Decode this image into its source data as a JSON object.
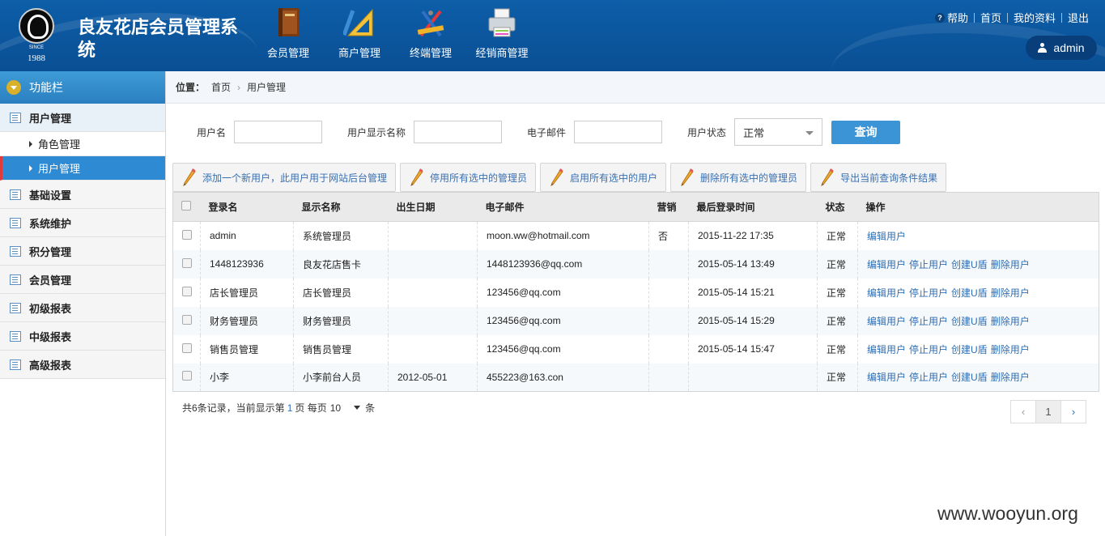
{
  "app": {
    "title": "良友花店会员管理系统",
    "logo_since": "SINCE",
    "logo_year": "1988"
  },
  "topnav": [
    {
      "label": "会员管理",
      "icon": "book-icon"
    },
    {
      "label": "商户管理",
      "icon": "ruler-triangle-icon"
    },
    {
      "label": "终端管理",
      "icon": "drafting-tools-icon"
    },
    {
      "label": "经销商管理",
      "icon": "printer-icon"
    }
  ],
  "toplinks": {
    "help": "帮助",
    "home": "首页",
    "profile": "我的资料",
    "logout": "退出"
  },
  "user": {
    "name": "admin"
  },
  "sidebar": {
    "header": "功能栏",
    "groups": [
      {
        "label": "用户管理",
        "subs": [
          {
            "label": "角色管理"
          },
          {
            "label": "用户管理"
          }
        ]
      },
      {
        "label": "基础设置"
      },
      {
        "label": "系统维护"
      },
      {
        "label": "积分管理"
      },
      {
        "label": "会员管理"
      },
      {
        "label": "初级报表"
      },
      {
        "label": "中级报表"
      },
      {
        "label": "高级报表"
      }
    ]
  },
  "breadcrumb": {
    "label": "位置：",
    "home": "首页",
    "current": "用户管理"
  },
  "search": {
    "username_label": "用户名",
    "username_value": "",
    "display_label": "用户显示名称",
    "display_value": "",
    "email_label": "电子邮件",
    "email_value": "",
    "status_label": "用户状态",
    "status_value": "正常",
    "query_button": "查询"
  },
  "toolbar": [
    "添加一个新用户，此用户用于网站后台管理",
    "停用所有选中的管理员",
    "启用所有选中的用户",
    "删除所有选中的管理员",
    "导出当前查询条件结果"
  ],
  "table": {
    "headers": [
      "登录名",
      "显示名称",
      "出生日期",
      "电子邮件",
      "营销",
      "最后登录时间",
      "状态",
      "操作"
    ],
    "rows": [
      {
        "login": "admin",
        "display": "系统管理员",
        "birth": "",
        "email": "moon.ww@hotmail.com",
        "marketing": "否",
        "last_login": "2015-11-22 17:35",
        "status": "正常",
        "ops": [
          "编辑用户"
        ]
      },
      {
        "login": "1448123936",
        "display": "良友花店售卡",
        "birth": "",
        "email": "1448123936@qq.com",
        "marketing": "",
        "last_login": "2015-05-14 13:49",
        "status": "正常",
        "ops": [
          "编辑用户",
          "停止用户",
          "创建U盾",
          "删除用户"
        ]
      },
      {
        "login": "店长管理员",
        "display": "店长管理员",
        "birth": "",
        "email": "123456@qq.com",
        "marketing": "",
        "last_login": "2015-05-14 15:21",
        "status": "正常",
        "ops": [
          "编辑用户",
          "停止用户",
          "创建U盾",
          "删除用户"
        ]
      },
      {
        "login": "财务管理员",
        "display": "财务管理员",
        "birth": "",
        "email": "123456@qq.com",
        "marketing": "",
        "last_login": "2015-05-14 15:29",
        "status": "正常",
        "ops": [
          "编辑用户",
          "停止用户",
          "创建U盾",
          "删除用户"
        ]
      },
      {
        "login": "销售员管理",
        "display": "销售员管理",
        "birth": "",
        "email": "123456@qq.com",
        "marketing": "",
        "last_login": "2015-05-14 15:47",
        "status": "正常",
        "ops": [
          "编辑用户",
          "停止用户",
          "创建U盾",
          "删除用户"
        ]
      },
      {
        "login": "小李",
        "display": "小李前台人员",
        "birth": "2012-05-01",
        "email": "455223@163.con",
        "marketing": "",
        "last_login": "",
        "status": "正常",
        "ops": [
          "编辑用户",
          "停止用户",
          "创建U盾",
          "删除用户"
        ]
      }
    ]
  },
  "footer": {
    "prefix": "共6条记录，当前显示第",
    "page": "1",
    "mid": "页 每页",
    "per_page": "10",
    "suffix": "条",
    "current_page": "1",
    "prev": "‹",
    "next": "›"
  },
  "watermark": "www.wooyun.org"
}
